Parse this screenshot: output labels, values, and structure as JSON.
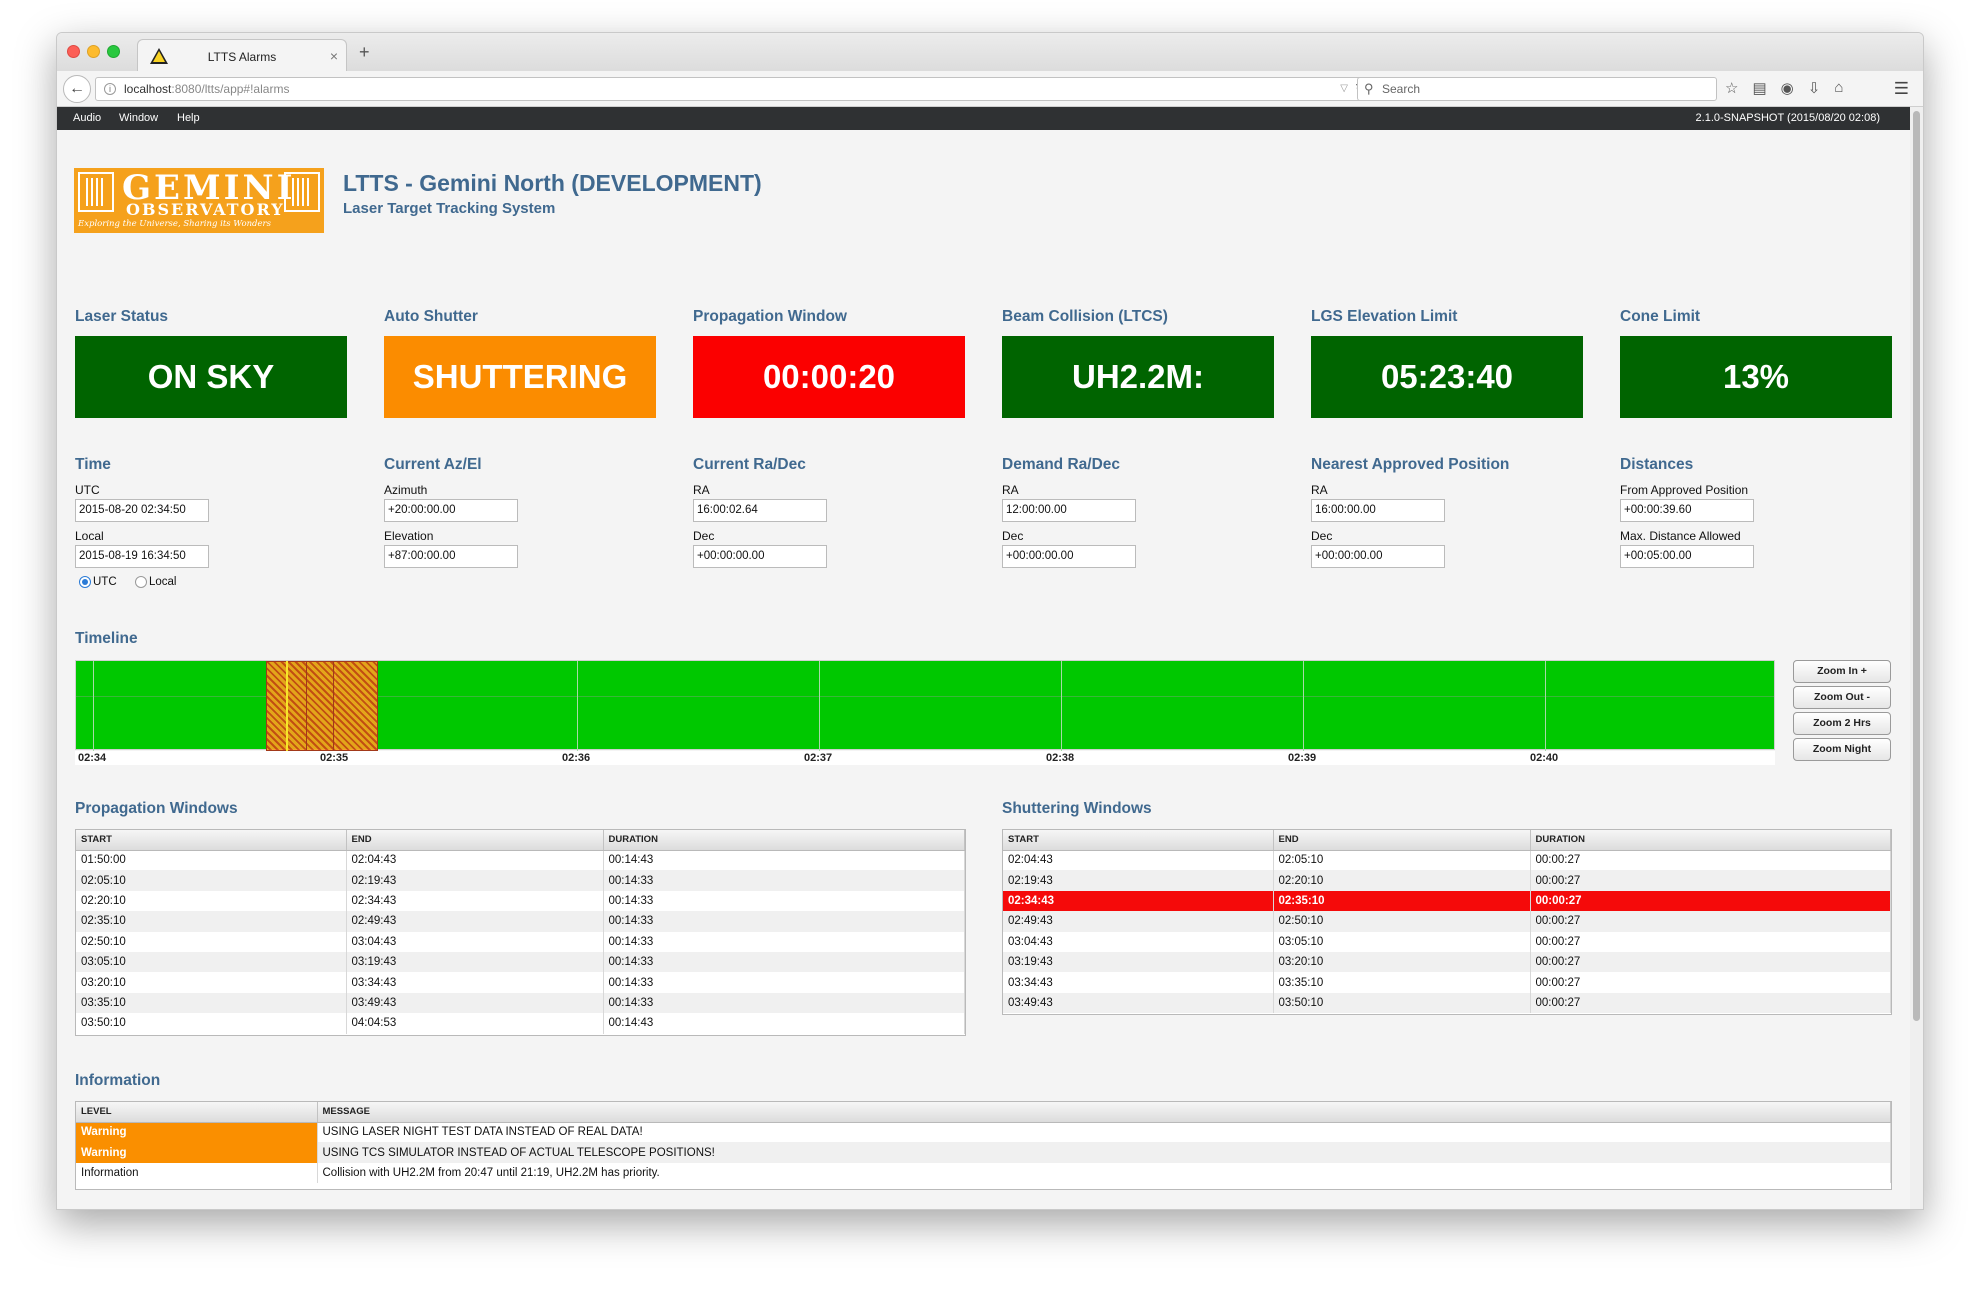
{
  "browser": {
    "tab_title": "LTTS Alarms",
    "tab_close": "×",
    "new_tab": "+",
    "url_host": "localhost",
    "url_rest": ":8080/ltts/app#!alarms",
    "search_placeholder": "Search"
  },
  "app_menu": {
    "items": [
      "Audio",
      "Window",
      "Help"
    ],
    "version": "2.1.0-SNAPSHOT (2015/08/20 02:08)"
  },
  "header": {
    "logo_word": "GEMINI",
    "logo_sub": "OBSERVATORY",
    "logo_tagline": "Exploring the Universe, Sharing its Wonders",
    "title": "LTTS - Gemini North (DEVELOPMENT)",
    "subtitle": "Laser Target Tracking System"
  },
  "status_boxes": [
    {
      "label": "Laser Status",
      "value": "ON SKY",
      "color": "#006400"
    },
    {
      "label": "Auto Shutter",
      "value": "SHUTTERING",
      "color": "#fb8c00"
    },
    {
      "label": "Propagation Window",
      "value": "00:00:20",
      "color": "#fb0000"
    },
    {
      "label": "Beam Collision (LTCS)",
      "value": "UH2.2M:",
      "color": "#006400"
    },
    {
      "label": "LGS Elevation Limit",
      "value": "05:23:40",
      "color": "#006400"
    },
    {
      "label": "Cone Limit",
      "value": "13%",
      "color": "#006400"
    }
  ],
  "time": {
    "heading": "Time",
    "utc_label": "UTC",
    "utc_value": "2015-08-20 02:34:50",
    "local_label": "Local",
    "local_value": "2015-08-19 16:34:50",
    "radio_utc": "UTC",
    "radio_local": "Local",
    "selected": "UTC"
  },
  "current_azel": {
    "heading": "Current Az/El",
    "az_label": "Azimuth",
    "az_value": "+20:00:00.00",
    "el_label": "Elevation",
    "el_value": "+87:00:00.00"
  },
  "current_radec": {
    "heading": "Current Ra/Dec",
    "ra_label": "RA",
    "ra_value": "16:00:02.64",
    "dec_label": "Dec",
    "dec_value": "+00:00:00.00"
  },
  "demand_radec": {
    "heading": "Demand Ra/Dec",
    "ra_label": "RA",
    "ra_value": "12:00:00.00",
    "dec_label": "Dec",
    "dec_value": "+00:00:00.00"
  },
  "nearest_position": {
    "heading": "Nearest Approved Position",
    "ra_label": "RA",
    "ra_value": "16:00:00.00",
    "dec_label": "Dec",
    "dec_value": "+00:00:00.00"
  },
  "distances": {
    "heading": "Distances",
    "from_label": "From Approved Position",
    "from_value": "+00:00:39.60",
    "max_label": "Max. Distance Allowed",
    "max_value": "+00:05:00.00"
  },
  "timeline": {
    "heading": "Timeline",
    "ticks": [
      "02:34",
      "02:35",
      "02:36",
      "02:37",
      "02:38",
      "02:39",
      "02:40"
    ],
    "background_color": "#00c800",
    "shutter_color": "#f7a21c",
    "zoom_in": "Zoom In +",
    "zoom_out": "Zoom Out -",
    "zoom_2hrs": "Zoom 2 Hrs",
    "zoom_night": "Zoom Night"
  },
  "propagation_windows": {
    "heading": "Propagation Windows",
    "columns": [
      "START",
      "END",
      "DURATION"
    ],
    "rows": [
      [
        "01:50:00",
        "02:04:43",
        "00:14:43"
      ],
      [
        "02:05:10",
        "02:19:43",
        "00:14:33"
      ],
      [
        "02:20:10",
        "02:34:43",
        "00:14:33"
      ],
      [
        "02:35:10",
        "02:49:43",
        "00:14:33"
      ],
      [
        "02:50:10",
        "03:04:43",
        "00:14:33"
      ],
      [
        "03:05:10",
        "03:19:43",
        "00:14:33"
      ],
      [
        "03:20:10",
        "03:34:43",
        "00:14:33"
      ],
      [
        "03:35:10",
        "03:49:43",
        "00:14:33"
      ],
      [
        "03:50:10",
        "04:04:53",
        "00:14:43"
      ]
    ]
  },
  "shuttering_windows": {
    "heading": "Shuttering Windows",
    "columns": [
      "START",
      "END",
      "DURATION"
    ],
    "active_row": 2,
    "rows": [
      [
        "02:04:43",
        "02:05:10",
        "00:00:27"
      ],
      [
        "02:19:43",
        "02:20:10",
        "00:00:27"
      ],
      [
        "02:34:43",
        "02:35:10",
        "00:00:27"
      ],
      [
        "02:49:43",
        "02:50:10",
        "00:00:27"
      ],
      [
        "03:04:43",
        "03:05:10",
        "00:00:27"
      ],
      [
        "03:19:43",
        "03:20:10",
        "00:00:27"
      ],
      [
        "03:34:43",
        "03:35:10",
        "00:00:27"
      ],
      [
        "03:49:43",
        "03:50:10",
        "00:00:27"
      ]
    ]
  },
  "information": {
    "heading": "Information",
    "columns": [
      "LEVEL",
      "MESSAGE"
    ],
    "rows": [
      {
        "level": "Warning",
        "message": "USING LASER NIGHT TEST DATA INSTEAD OF REAL DATA!"
      },
      {
        "level": "Warning",
        "message": "USING TCS SIMULATOR INSTEAD OF ACTUAL TELESCOPE POSITIONS!"
      },
      {
        "level": "Information",
        "message": "Collision with UH2.2M from 20:47 until 21:19, UH2.2M has priority."
      }
    ]
  }
}
